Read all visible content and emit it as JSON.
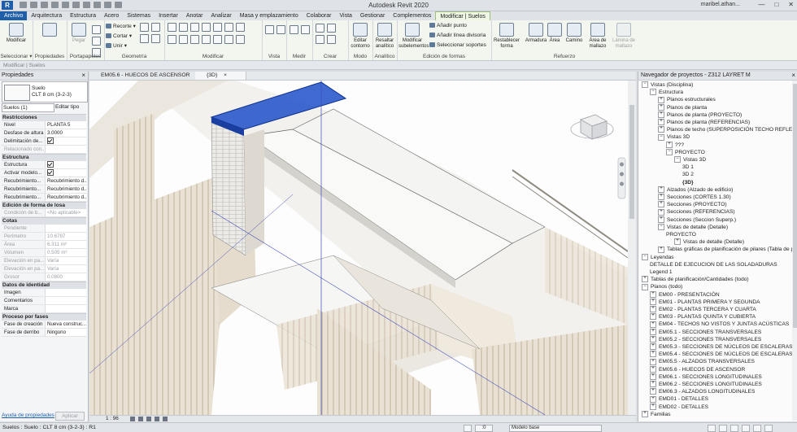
{
  "app": {
    "title": "Autodesk Revit 2020",
    "user": "maribel.athan...",
    "logo": "R",
    "window_controls": [
      "—",
      "□",
      "✕"
    ]
  },
  "tabs": [
    "Archivo",
    "Arquitectura",
    "Estructura",
    "Acero",
    "Sistemas",
    "Insertar",
    "Anotar",
    "Analizar",
    "Masa y emplazamiento",
    "Colaborar",
    "Vista",
    "Gestionar",
    "Complementos",
    "Modificar | Suelos"
  ],
  "ribbon": {
    "groups": [
      "Seleccionar",
      "Propiedades",
      "Portapapeles",
      "Geometría",
      "Modificar",
      "Vista",
      "Medir",
      "Crear",
      "Modo",
      "Analítico",
      "Edición de formas",
      "Refuerzo"
    ],
    "modify_btn": "Modificar",
    "selection_dropdown": "Seleccionar ▾",
    "properties_btn": "Propiedades",
    "paste_btn": "Pegar",
    "clipboard_items": [
      "Recorte ▾",
      "Cortar ▾",
      "Unir ▾"
    ],
    "mode": {
      "edit_contour": "Editar contorno"
    },
    "analytic": {
      "highlight_analytic": "Resaltar analítico"
    },
    "shape_editing": {
      "modify_subelements": "Modificar subelementos",
      "add_point": "Añadir punto",
      "add_split_line": "Añadir línea divisoria",
      "select_supports": "Seleccionar soportes"
    },
    "rebar": {
      "reset_shape": "Restablecer forma",
      "rebar": "Armadura",
      "area": "Área",
      "path": "Camino",
      "mesh_area": "Área de mallazo",
      "mesh_sheet": "Lámina de mallazo"
    }
  },
  "modebar": "Modificar | Suelos",
  "properties": {
    "header": "Propiedades",
    "type_family": "Suelo",
    "type_name": "CLT 8 cm (3-2-3)",
    "instance_selector": "Suelos (1)",
    "edit_type": "Editar tipo",
    "sections": [
      {
        "title": "Restricciones",
        "rows": [
          {
            "k": "Nivel",
            "v": "PLANTA 5"
          },
          {
            "k": "Desfase de altura",
            "v": "3.0000"
          },
          {
            "k": "Delimitación de...",
            "v": "check"
          },
          {
            "k": "Relacionado con...",
            "v": "",
            "dis": true
          }
        ]
      },
      {
        "title": "Estructura",
        "rows": [
          {
            "k": "Estructura",
            "v": "check"
          },
          {
            "k": "Activar modelo...",
            "v": "check"
          },
          {
            "k": "Recubrimiento...",
            "v": "Recubrimiento d..."
          },
          {
            "k": "Recubrimiento...",
            "v": "Recubrimiento d..."
          },
          {
            "k": "Recubrimiento...",
            "v": "Recubrimiento d..."
          }
        ]
      },
      {
        "title": "Edición de forma de losa",
        "rows": [
          {
            "k": "Condición de b...",
            "v": "<No aplicable>",
            "dis": true
          }
        ]
      },
      {
        "title": "Cotas",
        "rows": [
          {
            "k": "Pendiente",
            "v": "",
            "dis": true
          },
          {
            "k": "Perímetro",
            "v": "10.6787",
            "dis": true
          },
          {
            "k": "Área",
            "v": "6.311 m²",
            "dis": true
          },
          {
            "k": "Volumen",
            "v": "0.505 m³",
            "dis": true
          },
          {
            "k": "Elevación en pa...",
            "v": "Varía",
            "dis": true
          },
          {
            "k": "Elevación en pa...",
            "v": "Varía",
            "dis": true
          },
          {
            "k": "Grosor",
            "v": "0.0800",
            "dis": true
          }
        ]
      },
      {
        "title": "Datos de identidad",
        "rows": [
          {
            "k": "Imagen",
            "v": ""
          },
          {
            "k": "Comentarios",
            "v": ""
          },
          {
            "k": "Marca",
            "v": ""
          }
        ]
      },
      {
        "title": "Proceso por fases",
        "rows": [
          {
            "k": "Fase de creación",
            "v": "Nueva construc..."
          },
          {
            "k": "Fase de derribo",
            "v": "Ninguno"
          }
        ]
      }
    ],
    "help_link": "Ayuda de propiedades",
    "apply": "Aplicar"
  },
  "view_tabs": [
    {
      "label": "EM05.6 - HUECOS DE ASCENSOR",
      "active": false
    },
    {
      "label": "{3D}",
      "active": true
    }
  ],
  "view_close": "×",
  "view_status": {
    "scale": "1 : 96"
  },
  "project_browser": {
    "header": "Navegador de proyectos - Z312 LAYRET M",
    "nodes": [
      {
        "label": "Vistas (Disciplina)",
        "lvl": 0,
        "t": "−"
      },
      {
        "label": "Estructura",
        "lvl": 1,
        "t": "−"
      },
      {
        "label": "Planos estructurales",
        "lvl": 2,
        "t": "+"
      },
      {
        "label": "Planos de planta",
        "lvl": 2,
        "t": "+"
      },
      {
        "label": "Planos de planta (PROYECTO)",
        "lvl": 2,
        "t": "+"
      },
      {
        "label": "Planos de planta (REFERENCIAS)",
        "lvl": 2,
        "t": "+"
      },
      {
        "label": "Planos de techo (SUPERPOSICIÓN TECHO REFLEJADO)",
        "lvl": 2,
        "t": "+"
      },
      {
        "label": "Vistas 3D",
        "lvl": 2,
        "t": "−"
      },
      {
        "label": "???",
        "lvl": 3,
        "t": "+"
      },
      {
        "label": "PROYECTO",
        "lvl": 3,
        "t": "−"
      },
      {
        "label": "Vistas 3D",
        "lvl": 4,
        "t": "−"
      },
      {
        "label": "3D 1",
        "lvl": 5,
        "t": ""
      },
      {
        "label": "3D 2",
        "lvl": 5,
        "t": ""
      },
      {
        "label": "{3D}",
        "lvl": 5,
        "t": "",
        "bold": true
      },
      {
        "label": "Alzados (Alzado de edificio)",
        "lvl": 2,
        "t": "+"
      },
      {
        "label": "Secciones (CORTES 1.30)",
        "lvl": 2,
        "t": "+"
      },
      {
        "label": "Secciones (PROYECTO)",
        "lvl": 2,
        "t": "+"
      },
      {
        "label": "Secciones (REFERENCIAS)",
        "lvl": 2,
        "t": "+"
      },
      {
        "label": "Secciones (Seccion Superp.)",
        "lvl": 2,
        "t": "+"
      },
      {
        "label": "Vistas de detalle (Detalle)",
        "lvl": 2,
        "t": "−"
      },
      {
        "label": "PROYECTO",
        "lvl": 3,
        "t": ""
      },
      {
        "label": "Vistas de detalle (Detalle)",
        "lvl": 4,
        "t": "+"
      },
      {
        "label": "Tablas gráficas de planificación de pilares (Tabla de planif",
        "lvl": 2,
        "t": "+"
      },
      {
        "label": "Leyendas",
        "lvl": 0,
        "t": "−"
      },
      {
        "label": "DETALLE DE EJECUCION DE LAS SOLADADURAS",
        "lvl": 1,
        "t": ""
      },
      {
        "label": "Legend 1",
        "lvl": 1,
        "t": ""
      },
      {
        "label": "Tablas de planificación/Cantidades (todo)",
        "lvl": 0,
        "t": "+"
      },
      {
        "label": "Planos (todo)",
        "lvl": 0,
        "t": "−"
      },
      {
        "label": "EM00 - PRESENTACIÓN",
        "lvl": 1,
        "t": "+"
      },
      {
        "label": "EM01 - PLANTAS PRIMERA Y SEGUNDA",
        "lvl": 1,
        "t": "+"
      },
      {
        "label": "EM02 - PLANTAS TERCERA Y CUARTA",
        "lvl": 1,
        "t": "+"
      },
      {
        "label": "EM03 - PLANTAS QUINTA Y CUBIERTA",
        "lvl": 1,
        "t": "+"
      },
      {
        "label": "EM04 - TECHOS NO VISTOS Y JUNTAS ACÚSTICAS",
        "lvl": 1,
        "t": "+"
      },
      {
        "label": "EM05.1 - SECCIONES TRANSVERSALES",
        "lvl": 1,
        "t": "+"
      },
      {
        "label": "EM05.2 - SECCIONES TRANSVERSALES",
        "lvl": 1,
        "t": "+"
      },
      {
        "label": "EM05.3 - SECCIONES DE NÚCLEOS DE ESCALERAS",
        "lvl": 1,
        "t": "+"
      },
      {
        "label": "EM05.4 - SECCIONES DE NÚCLEOS DE ESCALERAS",
        "lvl": 1,
        "t": "+"
      },
      {
        "label": "EM05.5 - ALZADOS TRANSVERSALES",
        "lvl": 1,
        "t": "+"
      },
      {
        "label": "EM05.6 - HUECOS DE ASCENSOR",
        "lvl": 1,
        "t": "+"
      },
      {
        "label": "EM06.1 - SECCIONES LONGITUDINALES",
        "lvl": 1,
        "t": "+"
      },
      {
        "label": "EM06.2 - SECCIONES LONGITUDINALES",
        "lvl": 1,
        "t": "+"
      },
      {
        "label": "EM06.3 - ALZADOS LONGITUDINALES",
        "lvl": 1,
        "t": "+"
      },
      {
        "label": "EMD01 - DETALLES",
        "lvl": 1,
        "t": "+"
      },
      {
        "label": "EMD02 - DETALLES",
        "lvl": 1,
        "t": "+"
      },
      {
        "label": "Familias",
        "lvl": 0,
        "t": "+"
      }
    ]
  },
  "statusbar": {
    "left": "Suelos : Suelo : CLT 8 cm (3-2-3) : R1",
    "model": "Modelo base",
    "zoom": ":0"
  },
  "colors": {
    "selection": "#1f57c9",
    "ribbon_active": "#eef7e4",
    "file_tab": "#1f5ea8"
  }
}
